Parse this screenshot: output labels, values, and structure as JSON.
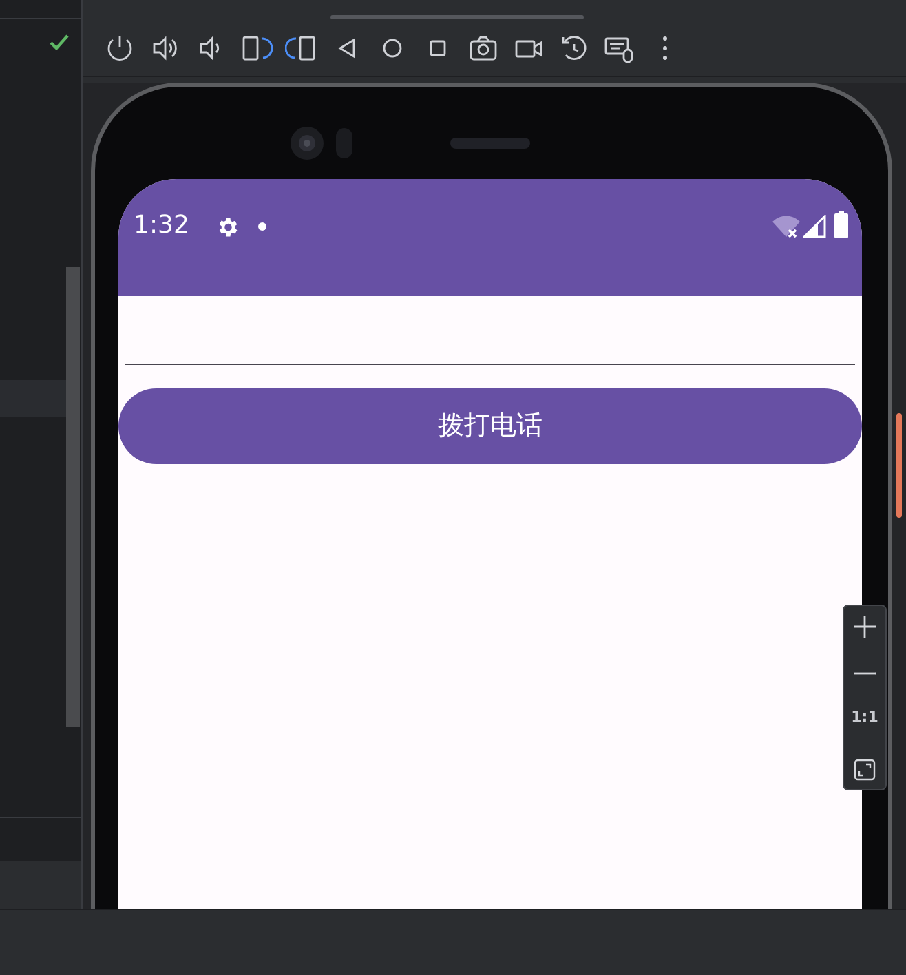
{
  "status_bar": {
    "time": "1:32"
  },
  "call_button": {
    "label": "拨打电话"
  },
  "zoom_controls": {
    "reset_label": "1:1"
  }
}
